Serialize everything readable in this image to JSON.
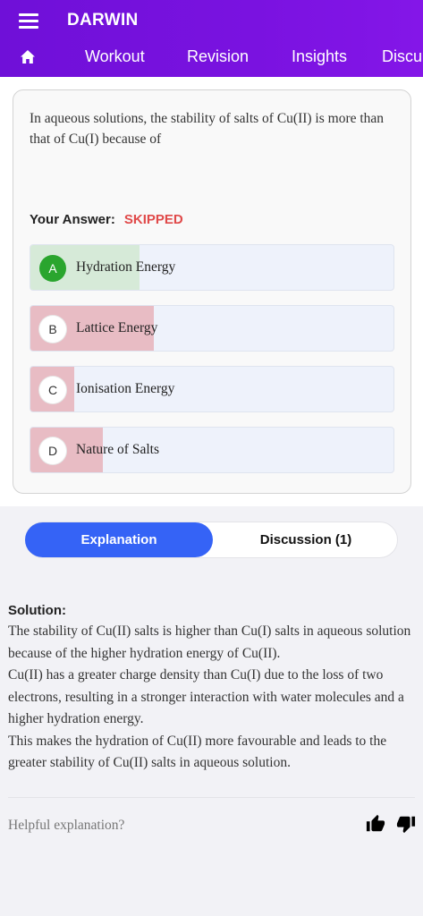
{
  "header": {
    "app_title": "DARWIN",
    "nav": [
      "Workout",
      "Revision",
      "Insights",
      "Discu"
    ]
  },
  "question": {
    "text": "In aqueous solutions, the stability of salts of Cu(II) is more than that of Cu(I) because of",
    "your_answer_label": "Your Answer:",
    "your_answer_value": "SKIPPED",
    "options": [
      {
        "letter": "A",
        "text": "Hydration Energy",
        "correct": true,
        "response_fraction": 0.3
      },
      {
        "letter": "B",
        "text": "Lattice Energy",
        "correct": false,
        "response_fraction": 0.34
      },
      {
        "letter": "C",
        "text": "Ionisation Energy",
        "correct": false,
        "response_fraction": 0.12
      },
      {
        "letter": "D",
        "text": "Nature of Salts",
        "correct": false,
        "response_fraction": 0.2
      }
    ]
  },
  "tabs": {
    "explanation": "Explanation",
    "discussion": "Discussion (1)"
  },
  "solution": {
    "heading": "Solution:",
    "paragraphs": [
      "The stability of Cu(II) salts is higher than Cu(I) salts in aqueous solution because of the higher hydration energy of Cu(II).",
      "Cu(II) has a greater charge density than Cu(I) due to the loss of two electrons, resulting in a stronger interaction with water molecules and a higher hydration energy.",
      "This makes the hydration of Cu(II) more favourable and leads to the greater stability of Cu(II) salts in aqueous solution."
    ]
  },
  "feedback": {
    "prompt": "Helpful explanation?"
  },
  "colors": {
    "header": "#7a12e0",
    "correct_fill": "#d6ead8",
    "wrong_fill": "#e8bcc4",
    "correct_badge": "#2aa52e",
    "skipped": "#e04a4a",
    "active_tab": "#3563f6"
  },
  "icons": [
    "hamburger-icon",
    "home-icon",
    "thumbs-up-icon",
    "thumbs-down-icon"
  ]
}
